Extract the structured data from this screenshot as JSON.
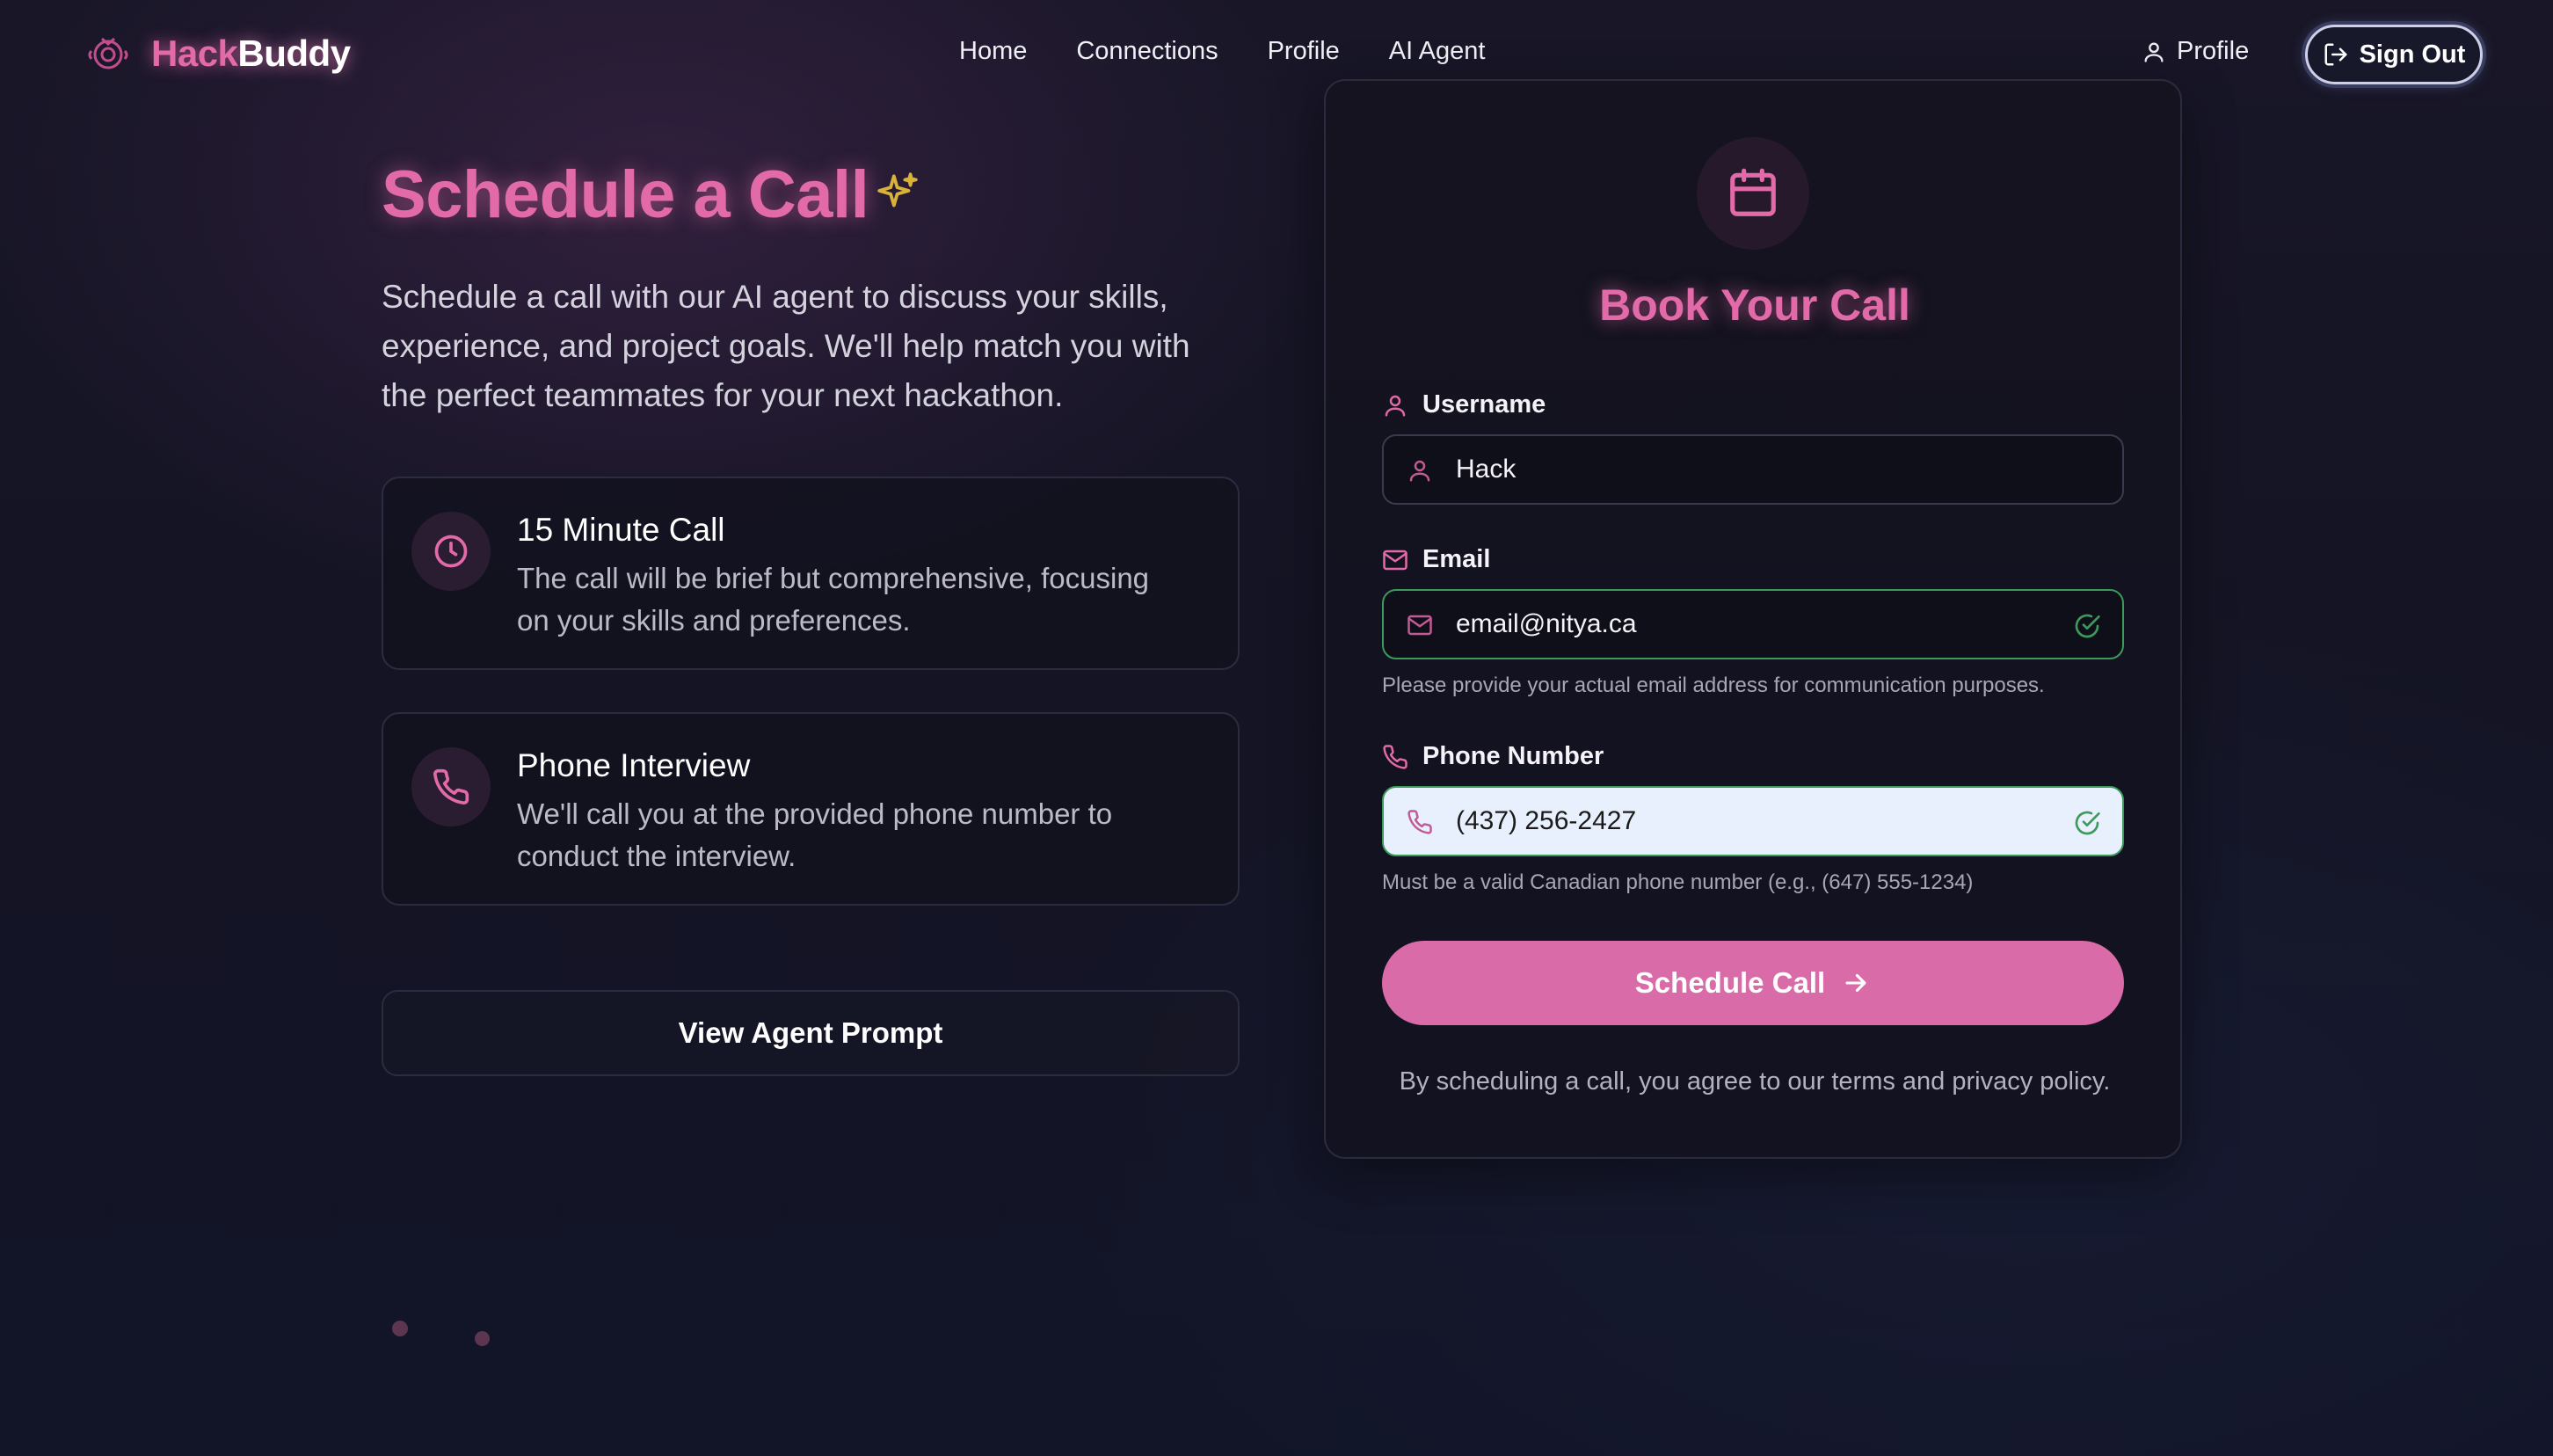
{
  "nav": {
    "logo_hack": "Hack",
    "logo_buddy": "Buddy",
    "links": [
      "Home",
      "Connections",
      "Profile",
      "AI Agent"
    ],
    "profile_label": "Profile",
    "signout_label": "Sign Out"
  },
  "hero": {
    "title": "Schedule a Call",
    "description": "Schedule a call with our AI agent to discuss your skills, experience, and project goals. We'll help match you with the perfect teammates for your next hackathon."
  },
  "features": [
    {
      "icon": "clock-icon",
      "title": "15 Minute Call",
      "text": "The call will be brief but comprehensive, focusing on your skills and preferences."
    },
    {
      "icon": "phone-icon",
      "title": "Phone Interview",
      "text": "We'll call you at the provided phone number to conduct the interview."
    }
  ],
  "agent_prompt_label": "View Agent Prompt",
  "form": {
    "title": "Book Your Call",
    "username": {
      "label": "Username",
      "value": "Hack"
    },
    "email": {
      "label": "Email",
      "value": "email@nitya.ca",
      "hint": "Please provide your actual email address for communication purposes."
    },
    "phone": {
      "label": "Phone Number",
      "value": "(437) 256-2427",
      "hint": "Must be a valid Canadian phone number (e.g., (647) 555-1234)"
    },
    "submit_label": "Schedule Call",
    "terms": "By scheduling a call, you agree to our terms and privacy policy."
  },
  "colors": {
    "accent_pink": "#e26aa9",
    "button_pink": "#d96ba9",
    "valid_green": "#3c9a5a",
    "sparkle_gold": "#d9b23a",
    "background": "#141424"
  }
}
